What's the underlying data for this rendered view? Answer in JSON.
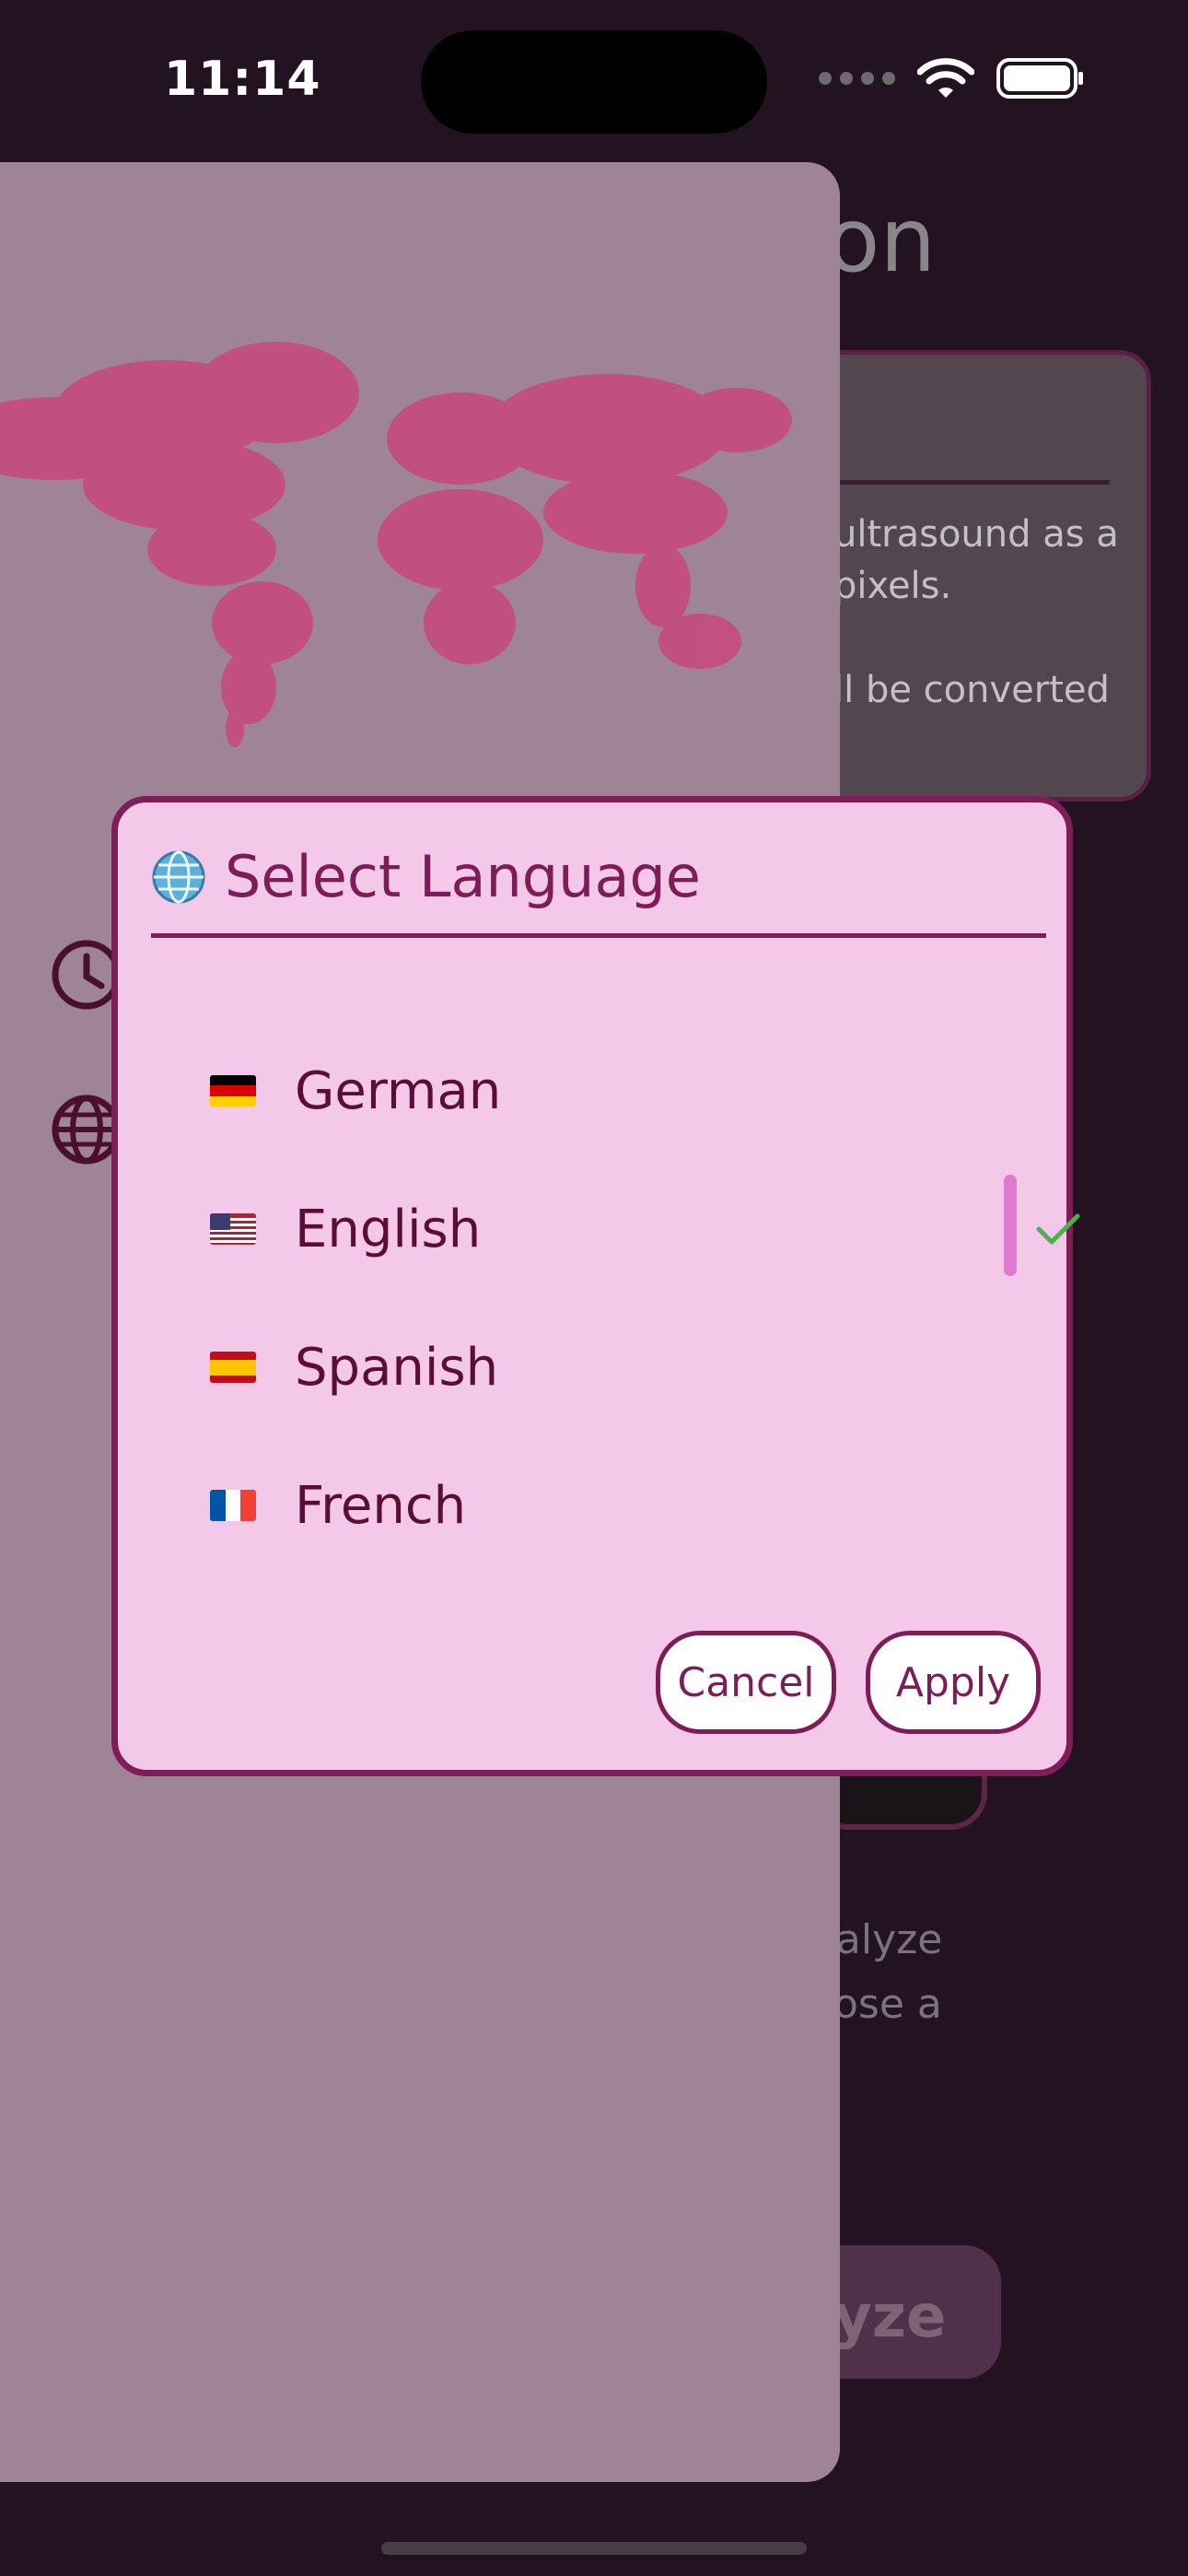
{
  "status_bar": {
    "time": "11:14",
    "icons": [
      "cellular-icon",
      "wifi-icon",
      "battery-icon"
    ]
  },
  "background": {
    "title_fragment": "ion",
    "card_lines": [
      "ultrasound as a",
      "pixels.",
      "ll be converted"
    ],
    "lines_lower": [
      "nalyze",
      "ose a"
    ],
    "button_fragment": "yze"
  },
  "drawer": {
    "icons": [
      "world-map-image",
      "clock-icon",
      "globe-icon"
    ]
  },
  "dialog": {
    "title_icon": "globe-icon",
    "title": "Select Language",
    "languages": [
      {
        "flag": "flag-germany-icon",
        "label": "German",
        "selected": false
      },
      {
        "flag": "flag-usa-icon",
        "label": "English",
        "selected": true
      },
      {
        "flag": "flag-spain-icon",
        "label": "Spanish",
        "selected": false
      },
      {
        "flag": "flag-france-icon",
        "label": "French",
        "selected": false
      }
    ],
    "cancel_label": "Cancel",
    "apply_label": "Apply"
  },
  "colors": {
    "page_bg": "#231321",
    "drawer_bg": "#9e8494",
    "dialog_bg": "#f3c8e8",
    "accent": "#7c1d58",
    "check": "#4caf50",
    "map_dots": "#c8487e"
  }
}
